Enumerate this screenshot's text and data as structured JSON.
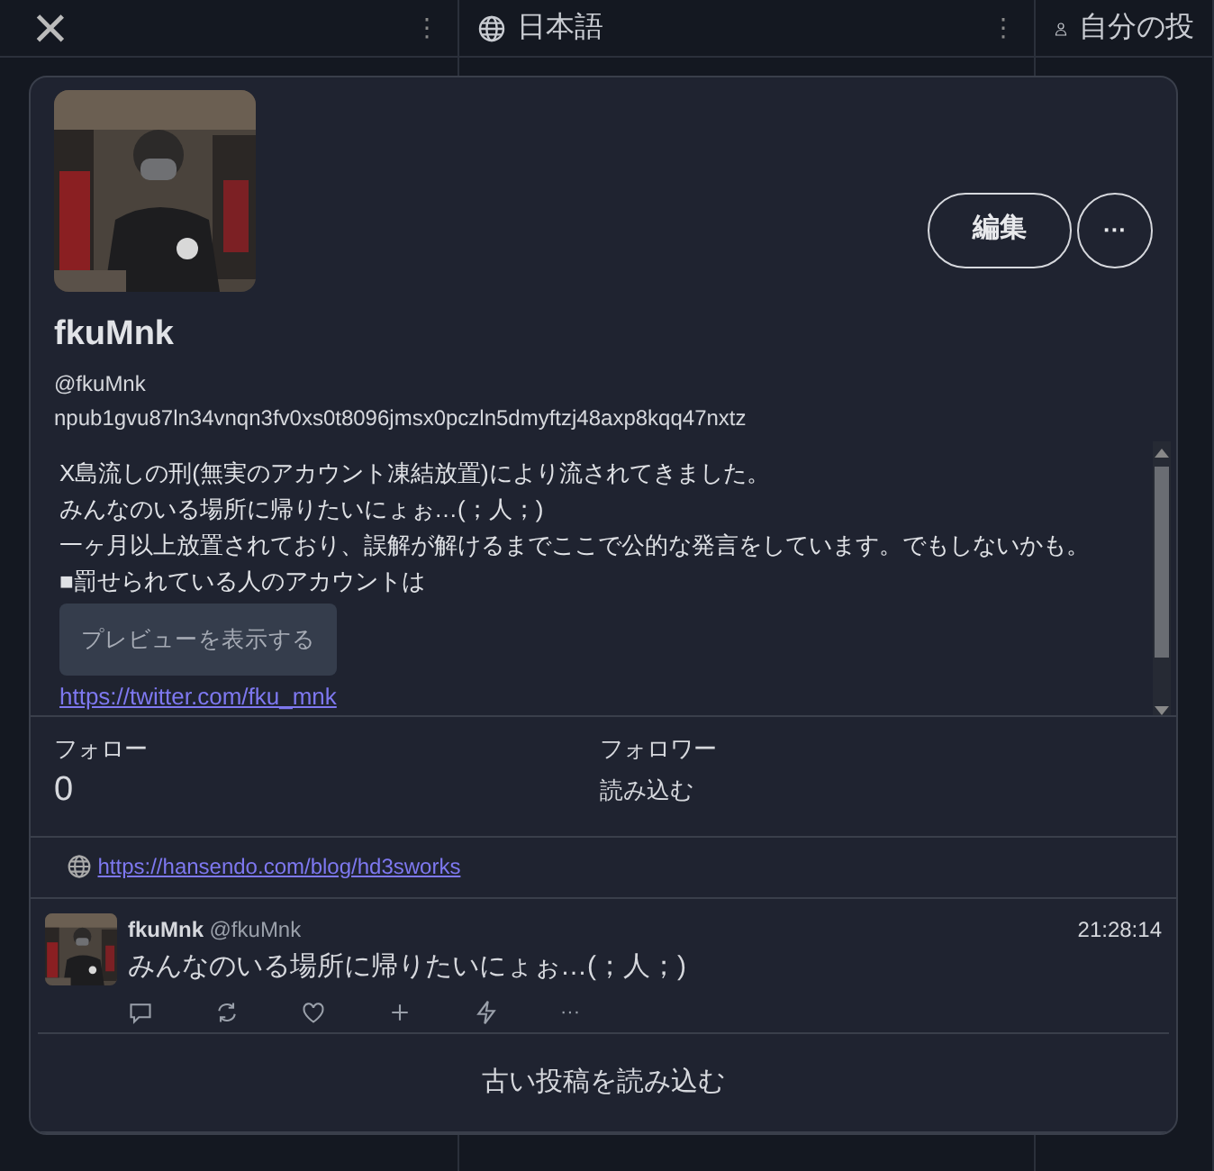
{
  "columns": [
    {
      "kind": "close",
      "label": "×",
      "menu": "⋮"
    },
    {
      "kind": "globe",
      "label": "日本語",
      "menu": "⋮"
    },
    {
      "kind": "user",
      "label": "自分の投"
    }
  ],
  "profile": {
    "name": "fkuMnk",
    "handle": "@fkuMnk",
    "npub": "npub1gvu87ln34vnqn3fv0xs0t8096jmsx0pczln5dmyftzj48axp8kqq47nxtz",
    "edit_button": "編集",
    "more_button": "···",
    "bio": [
      "X島流しの刑(無実のアカウント凍結放置)により流されてきました。",
      "みんなのいる場所に帰りたいにょぉ…(；人；)",
      "一ヶ月以上放置されており、誤解が解けるまでここで公的な発言をしています。でもしないかも。",
      "■罰せられている人のアカウントは"
    ],
    "preview_button": "プレビューを表示する",
    "bio_link": "https://twitter.com/fku_mnk",
    "stats": [
      {
        "label": "フォロー",
        "value": "0",
        "kind": "count"
      },
      {
        "label": "フォロワー",
        "value": "読み込む",
        "kind": "action"
      }
    ],
    "website": "https://hansendo.com/blog/hd3sworks"
  },
  "post": {
    "name": "fkuMnk",
    "handle": "@fkuMnk",
    "time": "21:28:14",
    "text": "みんなのいる場所に帰りたいにょぉ…(；人；)",
    "actions": [
      {
        "kind": "reply"
      },
      {
        "kind": "repost"
      },
      {
        "kind": "like"
      },
      {
        "kind": "add"
      },
      {
        "kind": "zap"
      },
      {
        "kind": "more",
        "label": "···"
      }
    ]
  },
  "load_older": "古い投稿を読み込む"
}
